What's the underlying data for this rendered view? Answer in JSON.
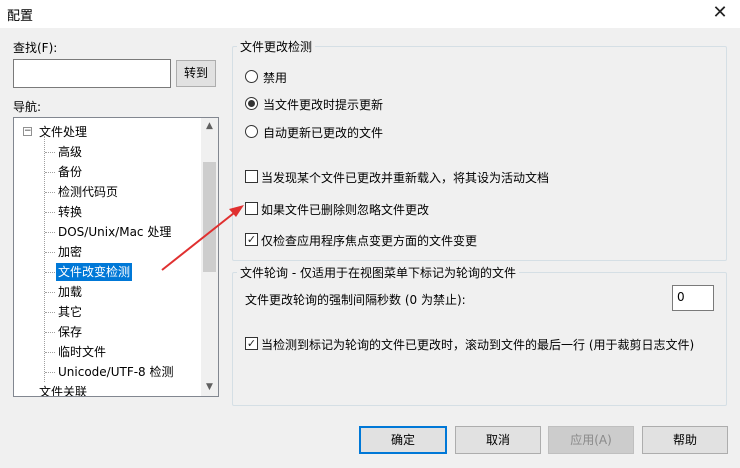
{
  "window": {
    "title": "配置",
    "close_glyph": "✕"
  },
  "find": {
    "label": "查找(F):",
    "value": "",
    "goto_label": "转到"
  },
  "nav": {
    "label": "导航:",
    "items": [
      {
        "label": "文件处理",
        "level": 0,
        "expander": "⊟"
      },
      {
        "label": "高级",
        "level": 1
      },
      {
        "label": "备份",
        "level": 1
      },
      {
        "label": "检测代码页",
        "level": 1
      },
      {
        "label": "转换",
        "level": 1
      },
      {
        "label": "DOS/Unix/Mac 处理",
        "level": 1
      },
      {
        "label": "加密",
        "level": 1
      },
      {
        "label": "文件改变检测",
        "level": 1,
        "selected": true
      },
      {
        "label": "加载",
        "level": 1
      },
      {
        "label": "其它",
        "level": 1
      },
      {
        "label": "保存",
        "level": 1
      },
      {
        "label": "临时文件",
        "level": 1
      },
      {
        "label": "Unicode/UTF-8 检测",
        "level": 1
      },
      {
        "label": "文件关联",
        "level": 0
      }
    ],
    "scroll_up": "▲",
    "scroll_down": "▼"
  },
  "change_detection": {
    "title": "文件更改检测",
    "radios": [
      {
        "label": "禁用",
        "checked": false
      },
      {
        "label": "当文件更改时提示更新",
        "checked": true
      },
      {
        "label": "自动更新已更改的文件",
        "checked": false
      }
    ],
    "checkboxes": [
      {
        "label": "当发现某个文件已更改并重新载入，将其设为活动文档",
        "checked": false
      },
      {
        "label": "如果文件已删除则忽略文件更改",
        "checked": false
      },
      {
        "label": "仅检查应用程序焦点变更方面的文件变更",
        "checked": true
      }
    ]
  },
  "polling": {
    "title": "文件轮询 - 仅适用于在视图菜单下标记为轮询的文件",
    "interval_label": "文件更改轮询的强制间隔秒数 (0 为禁止):",
    "interval_value": "0",
    "scroll_checkbox": {
      "label": "当检测到标记为轮询的文件已更改时，滚动到文件的最后一行 (用于裁剪日志文件)",
      "checked": true
    }
  },
  "buttons": {
    "ok": "确定",
    "cancel": "取消",
    "apply": "应用(A)",
    "help": "帮助"
  },
  "check_glyph": "✓",
  "annotation_color": "#e03030"
}
